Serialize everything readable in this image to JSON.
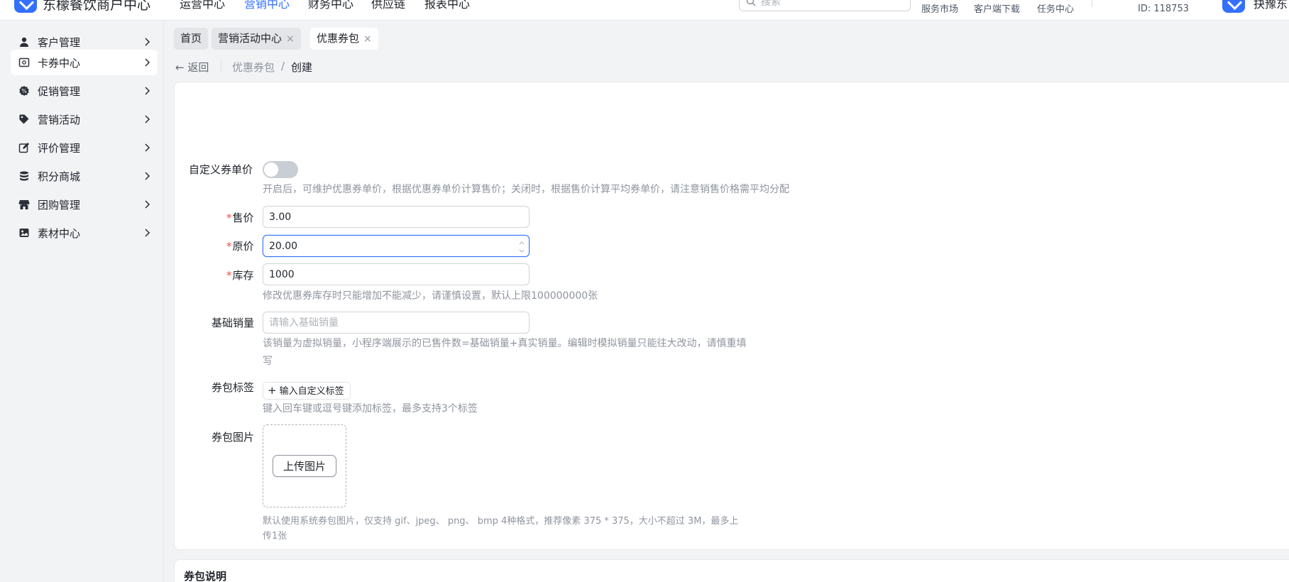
{
  "app": {
    "title": "东檬餐饮商户中心"
  },
  "topnav": [
    {
      "label": "运营中心"
    },
    {
      "label": "营销中心"
    },
    {
      "label": "财务中心"
    },
    {
      "label": "供应链"
    },
    {
      "label": "报表中心"
    }
  ],
  "search": {
    "placeholder": "搜索"
  },
  "top_links": [
    {
      "label": "服务市场"
    },
    {
      "label": "客户端下载"
    },
    {
      "label": "任务中心"
    }
  ],
  "merchant": {
    "id": "ID: 118753"
  },
  "user": {
    "name": "抉豫东"
  },
  "sidebar": {
    "items": [
      {
        "label": "客户管理",
        "icon": "user-icon"
      },
      {
        "label": "卡券中心",
        "icon": "card-icon",
        "active": true
      },
      {
        "label": "促销管理",
        "icon": "promotion-icon"
      },
      {
        "label": "营销活动",
        "icon": "tag-icon"
      },
      {
        "label": "评价管理",
        "icon": "review-icon"
      },
      {
        "label": "积分商城",
        "icon": "coins-icon"
      },
      {
        "label": "团购管理",
        "icon": "shop-icon"
      },
      {
        "label": "素材中心",
        "icon": "image-icon"
      }
    ]
  },
  "tabs": [
    {
      "label": "首页"
    },
    {
      "label": "营销活动中心",
      "close": "×"
    },
    {
      "label": "优惠券包",
      "close": "×",
      "active": true
    }
  ],
  "breadcrumb": {
    "back": "返回",
    "parent": "优惠券包",
    "separator": "/",
    "current": "创建"
  },
  "form": {
    "custom_price": {
      "label": "自定义券单价",
      "enabled": false,
      "help": "开启后，可维护优惠券单价，根据优惠券单价计算售价；关闭时，根据售价计算平均券单价，请注意销售价格需平均分配"
    },
    "sale_price": {
      "required": "*",
      "label": "售价",
      "value": "3.00"
    },
    "original_price": {
      "required": "*",
      "label": "原价",
      "value": "20.00"
    },
    "stock": {
      "required": "*",
      "label": "库存",
      "value": "1000",
      "help": "修改优惠券库存时只能增加不能减少，请谨慎设置，默认上限100000000张"
    },
    "base_sales": {
      "label": "基础销量",
      "placeholder": "请输入基础销量",
      "help_line1": "该销量为虚拟销量，小程序端展示的已售件数=基础销量+真实销量。编辑时模拟销量只能往大改动，请慎重填",
      "help_line2": "写"
    },
    "tags": {
      "label": "券包标签",
      "add_button": "输入自定义标签",
      "help": "键入回车键或逗号键添加标签，最多支持3个标签"
    },
    "image": {
      "label": "券包图片",
      "upload_button": "上传图片",
      "help_line1": "默认使用系统券包图片，仅支持 gif、jpeg、 png、 bmp 4种格式，推荐像素 375 * 375，大小不超过 3M，最多上",
      "help_line2": "传1张"
    }
  },
  "section2": {
    "title": "券包说明"
  },
  "colors": {
    "accent": "#3370ff",
    "required": "#f54a45"
  }
}
